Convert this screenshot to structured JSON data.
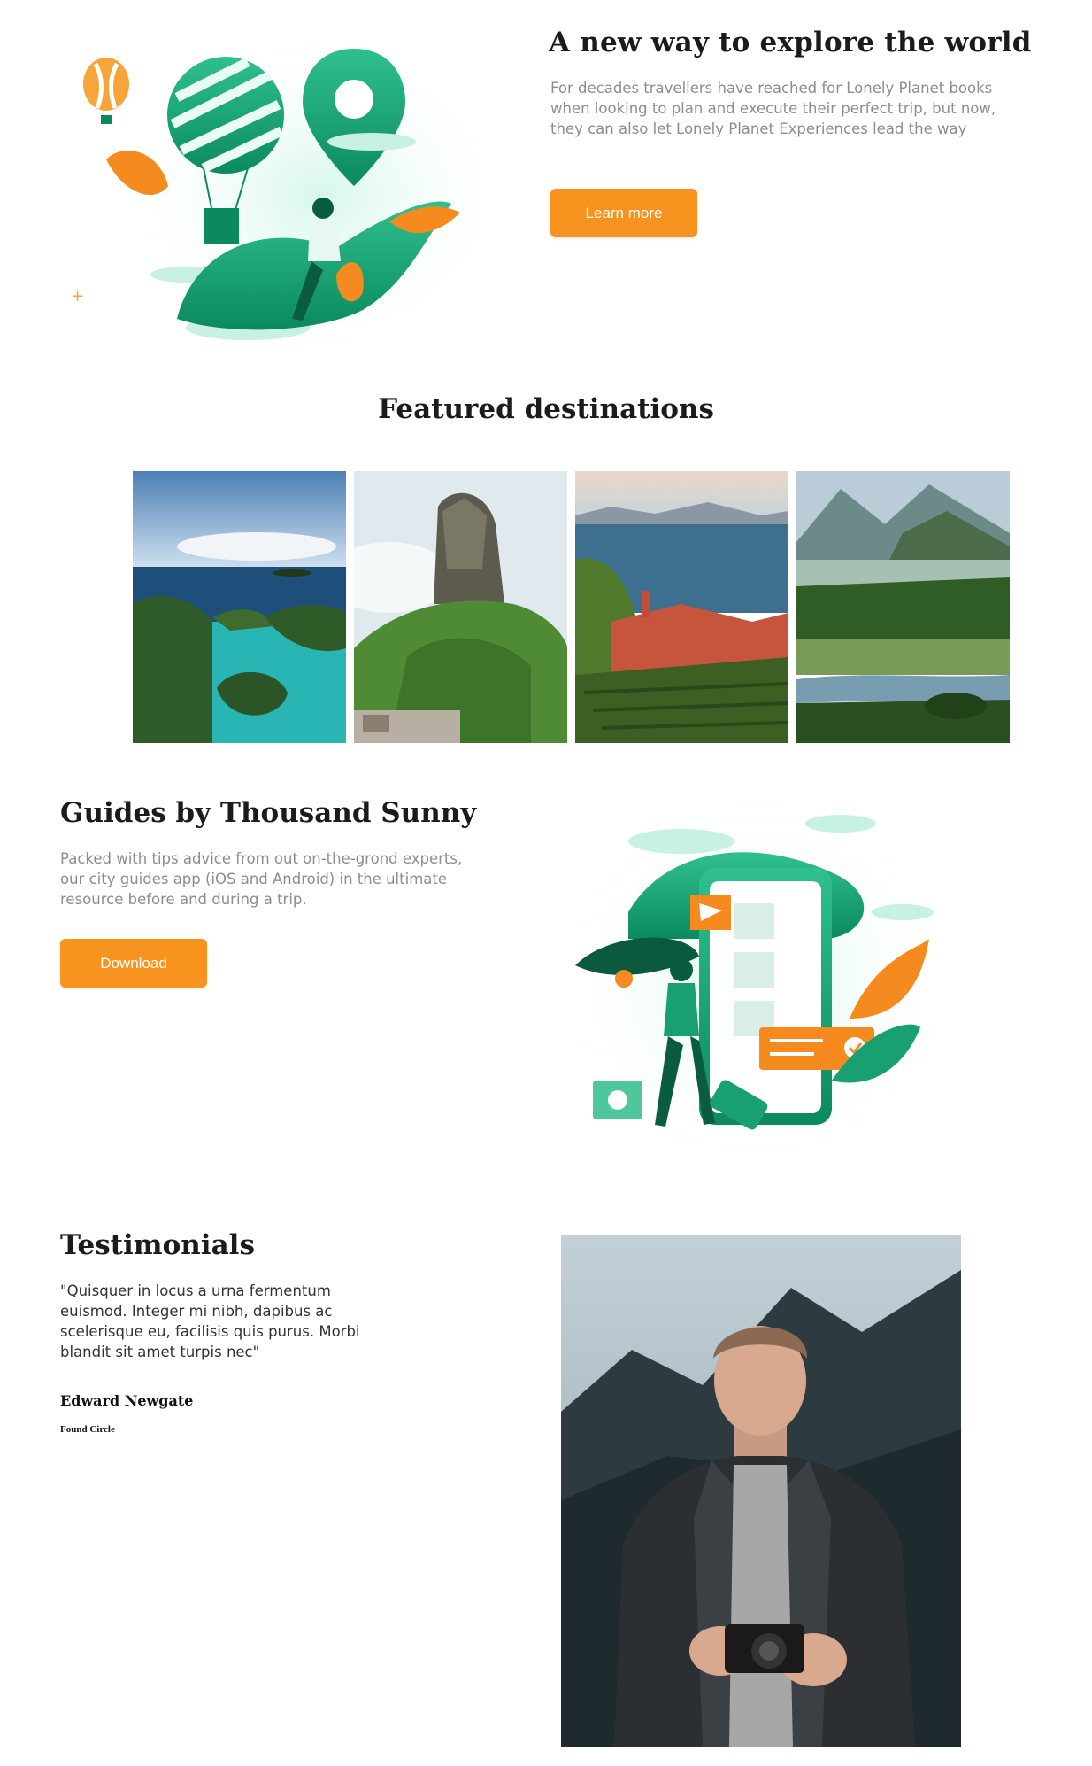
{
  "hero": {
    "title": "A new way to explore the world",
    "description": "For decades travellers have reached for Lonely Planet books when looking to plan and execute their perfect trip, but now, they can also let Lonely Planet Experiences lead the way",
    "cta_label": "Learn more",
    "illustration_icon": "hot-air-balloon-illustration"
  },
  "featured": {
    "title": "Featured destinations",
    "images": [
      "tropical-islands-image",
      "rock-mountain-image",
      "coastal-village-image",
      "river-valley-image"
    ]
  },
  "guides": {
    "title": "Guides by Thousand Sunny",
    "description": "Packed with tips advice from out on-the-grond experts, our city guides app (iOS and Android) in the ultimate resource before and during a trip.",
    "cta_label": "Download",
    "illustration_icon": "phone-traveller-illustration"
  },
  "testimonials": {
    "title": "Testimonials",
    "quote": "\"Quisquer in locus a urna fermentum euismod. Integer mi nibh, dapibus ac scelerisque eu, facilisis quis purus. Morbi blandit sit amet turpis nec\"",
    "name": "Edward Newgate",
    "role": "Found Circle",
    "photo": "photographer-portrait-image"
  },
  "colors": {
    "accent": "#f7931e",
    "green": "#1fa67a",
    "text_muted": "#8d8d8d"
  }
}
